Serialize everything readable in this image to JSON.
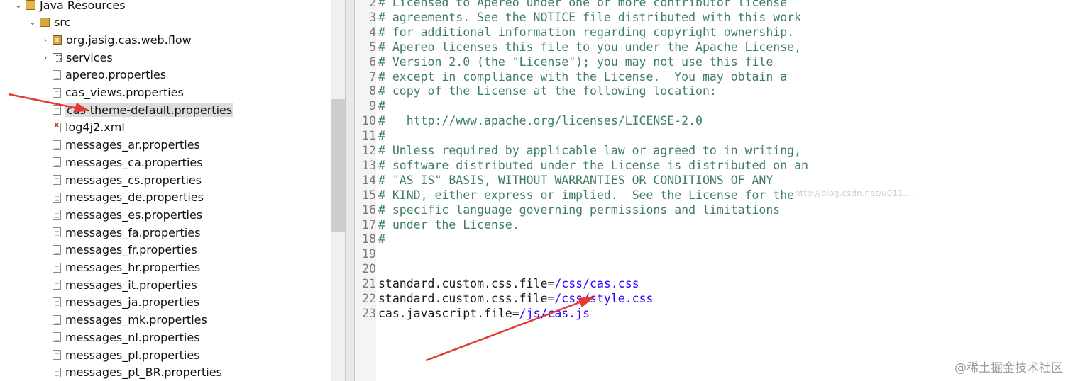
{
  "explorer": {
    "items": [
      {
        "label": "Java Resources",
        "expanded": true,
        "icon": "java-resources-icon"
      },
      {
        "label": "src",
        "expanded": true,
        "icon": "source-folder-icon"
      },
      {
        "label": "org.jasig.cas.web.flow",
        "expanded": false,
        "icon": "package-icon"
      },
      {
        "label": "services",
        "expanded": false,
        "icon": "services-folder-icon"
      },
      {
        "label": "apereo.properties",
        "icon": "properties-file-icon"
      },
      {
        "label": "cas_views.properties",
        "icon": "properties-file-icon"
      },
      {
        "label": "cas-theme-default.properties",
        "icon": "properties-file-icon",
        "selected": true
      },
      {
        "label": "log4j2.xml",
        "icon": "xml-file-icon"
      },
      {
        "label": "messages_ar.properties",
        "icon": "properties-file-icon"
      },
      {
        "label": "messages_ca.properties",
        "icon": "properties-file-icon"
      },
      {
        "label": "messages_cs.properties",
        "icon": "properties-file-icon"
      },
      {
        "label": "messages_de.properties",
        "icon": "properties-file-icon"
      },
      {
        "label": "messages_es.properties",
        "icon": "properties-file-icon"
      },
      {
        "label": "messages_fa.properties",
        "icon": "properties-file-icon"
      },
      {
        "label": "messages_fr.properties",
        "icon": "properties-file-icon"
      },
      {
        "label": "messages_hr.properties",
        "icon": "properties-file-icon"
      },
      {
        "label": "messages_it.properties",
        "icon": "properties-file-icon"
      },
      {
        "label": "messages_ja.properties",
        "icon": "properties-file-icon"
      },
      {
        "label": "messages_mk.properties",
        "icon": "properties-file-icon"
      },
      {
        "label": "messages_nl.properties",
        "icon": "properties-file-icon"
      },
      {
        "label": "messages_pl.properties",
        "icon": "properties-file-icon"
      },
      {
        "label": "messages_pt_BR.properties",
        "icon": "properties-file-icon"
      }
    ]
  },
  "editor": {
    "lines": [
      {
        "num": "2",
        "type": "comment",
        "text": "# Licensed to Apereo under one or more contributor license"
      },
      {
        "num": "3",
        "type": "comment",
        "text": "# agreements. See the NOTICE file distributed with this work"
      },
      {
        "num": "4",
        "type": "comment",
        "text": "# for additional information regarding copyright ownership."
      },
      {
        "num": "5",
        "type": "comment",
        "text": "# Apereo licenses this file to you under the Apache License,"
      },
      {
        "num": "6",
        "type": "comment",
        "text": "# Version 2.0 (the \"License\"); you may not use this file"
      },
      {
        "num": "7",
        "type": "comment",
        "text": "# except in compliance with the License.  You may obtain a"
      },
      {
        "num": "8",
        "type": "comment",
        "text": "# copy of the License at the following location:"
      },
      {
        "num": "9",
        "type": "comment",
        "text": "#"
      },
      {
        "num": "10",
        "type": "comment",
        "text": "#   http://www.apache.org/licenses/LICENSE-2.0"
      },
      {
        "num": "11",
        "type": "comment",
        "text": "#"
      },
      {
        "num": "12",
        "type": "comment",
        "text": "# Unless required by applicable law or agreed to in writing,"
      },
      {
        "num": "13",
        "type": "comment",
        "text": "# software distributed under the License is distributed on an"
      },
      {
        "num": "14",
        "type": "comment",
        "text": "# \"AS IS\" BASIS, WITHOUT WARRANTIES OR CONDITIONS OF ANY"
      },
      {
        "num": "15",
        "type": "comment",
        "text": "# KIND, either express or implied.  See the License for the"
      },
      {
        "num": "16",
        "type": "comment",
        "text": "# specific language governing permissions and limitations"
      },
      {
        "num": "17",
        "type": "comment",
        "text": "# under the License."
      },
      {
        "num": "18",
        "type": "comment",
        "text": "#"
      },
      {
        "num": "19",
        "type": "blank",
        "text": ""
      },
      {
        "num": "20",
        "type": "blank",
        "text": ""
      },
      {
        "num": "21",
        "type": "prop",
        "key": "standard.custom.css.file=",
        "value": "/css/cas.css"
      },
      {
        "num": "22",
        "type": "prop",
        "key": "standard.custom.css.file=",
        "value": "/css/style.css"
      },
      {
        "num": "23",
        "type": "prop",
        "key": "cas.javascript.file=",
        "value": "/js/cas.js"
      }
    ]
  },
  "watermark": "http://blog.csdn.net/u011.....",
  "site_mark": "@稀土掘金技术社区",
  "colors": {
    "comment": "#3f7f5f",
    "value": "#2a00ff",
    "annotation_arrow": "#e53935",
    "selection": "#dcdcdc"
  }
}
